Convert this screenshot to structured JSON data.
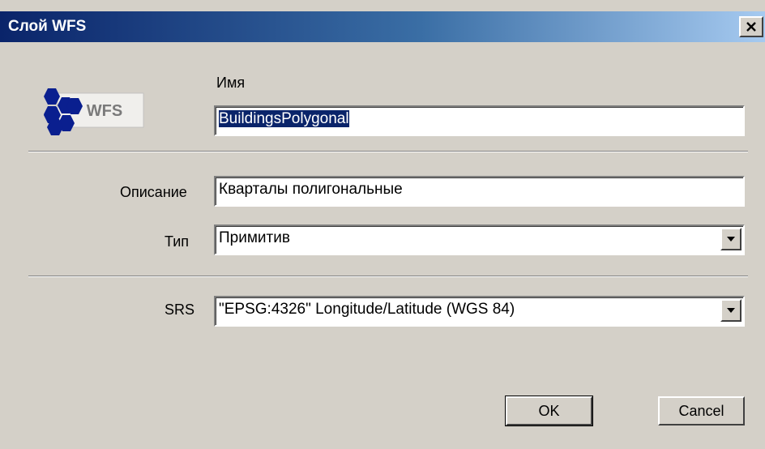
{
  "window": {
    "title": "Слой WFS"
  },
  "icons": {
    "close": "close-icon",
    "logo": "wfs-logo-icon",
    "dropdown": "chevron-down-icon"
  },
  "colors": {
    "titlebar_start": "#0a246a",
    "titlebar_end": "#a6caf0",
    "dialog_bg": "#d4d0c8",
    "selection": "#0a246a"
  },
  "logo": {
    "text": "WFS"
  },
  "name": {
    "label": "Имя",
    "value": "BuildingsPolygonal"
  },
  "description": {
    "label": "Описание",
    "value": "Кварталы полигональные"
  },
  "type": {
    "label": "Тип",
    "value": "Примитив"
  },
  "srs": {
    "label": "SRS",
    "value": "\"EPSG:4326\" Longitude/Latitude (WGS 84)"
  },
  "buttons": {
    "ok": "OK",
    "cancel": "Cancel"
  }
}
